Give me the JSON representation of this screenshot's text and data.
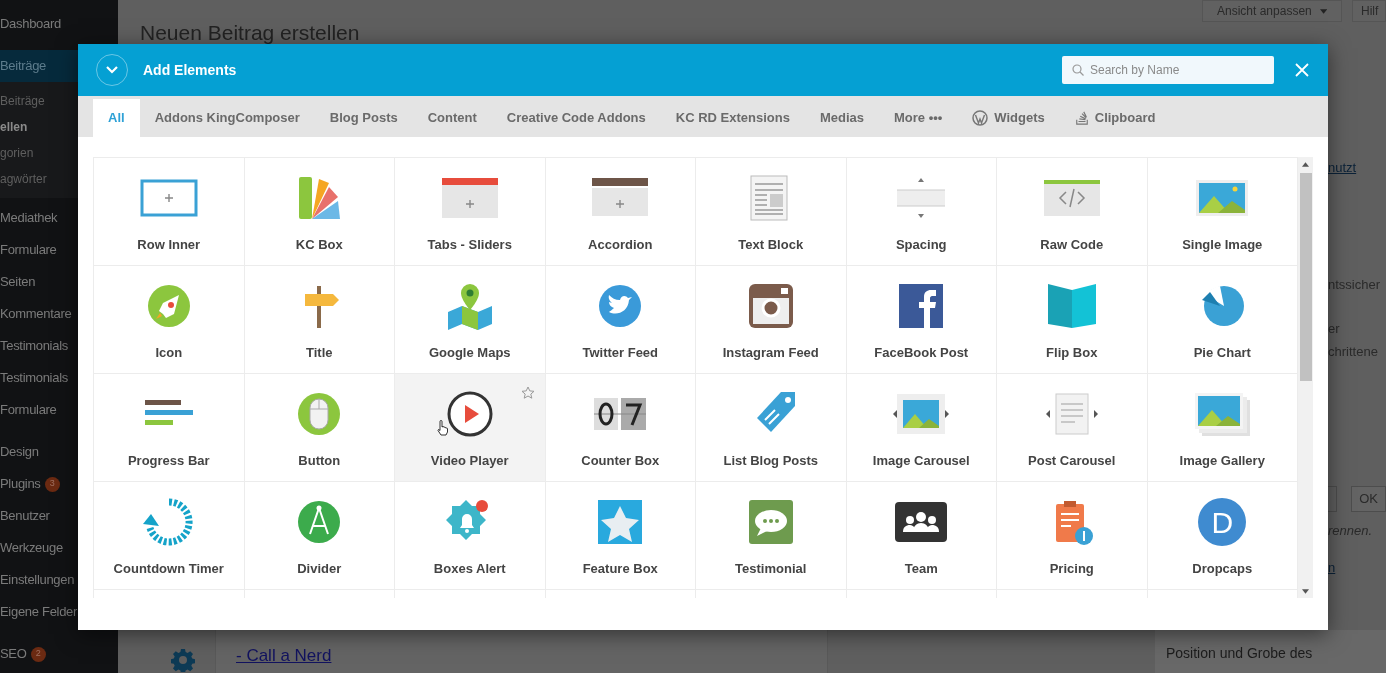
{
  "sidebar": {
    "groups": [
      [
        {
          "label": "Dashboard",
          "selected": false
        }
      ],
      [
        {
          "label": "Beiträge",
          "selected": true,
          "children": [
            {
              "label": "Beiträge",
              "current": false
            },
            {
              "label": "ellen",
              "current": true
            },
            {
              "label": "gorien",
              "current": false
            },
            {
              "label": "agwörter",
              "current": false
            }
          ]
        },
        {
          "label": "Mediathek",
          "selected": false
        },
        {
          "label": "Formulare",
          "selected": false
        },
        {
          "label": "Seiten",
          "selected": false
        },
        {
          "label": "Kommentare",
          "selected": false
        },
        {
          "label": "Testimonials",
          "selected": false
        },
        {
          "label": "Testimonials",
          "selected": false
        },
        {
          "label": "Formulare",
          "selected": false
        }
      ],
      [
        {
          "label": "Design",
          "selected": false
        },
        {
          "label": "Plugins",
          "selected": false,
          "badge": "3"
        },
        {
          "label": "Benutzer",
          "selected": false
        },
        {
          "label": "Werkzeuge",
          "selected": false
        },
        {
          "label": "Einstellungen",
          "selected": false
        },
        {
          "label": "Eigene Felder",
          "selected": false
        }
      ],
      [
        {
          "label": "SEO",
          "selected": false,
          "badge": "2"
        }
      ]
    ]
  },
  "page": {
    "title": "Neuen Beitrag erstellen",
    "header_buttons": [
      {
        "label": "Ansicht anpassen",
        "menu": true
      },
      {
        "label": "Hilf",
        "menu": false
      }
    ],
    "side_fragments": [
      {
        "text": "nutzt",
        "kind": "link"
      },
      {
        "text": "ntssicher",
        "kind": "text"
      },
      {
        "text": "er",
        "kind": "text"
      },
      {
        "text": "chrittene",
        "kind": "text"
      },
      {
        "text": "OK",
        "kind": "button"
      },
      {
        "text": "rennen.",
        "kind": "italic"
      },
      {
        "text": "n",
        "kind": "link"
      }
    ],
    "bottom_link": "- Call a Nerd",
    "bottom_panel_title": "Position und Grobe des"
  },
  "modal": {
    "title": "Add Elements",
    "search": {
      "placeholder": "Search by Name"
    },
    "tabs": [
      {
        "label": "All",
        "selected": true
      },
      {
        "label": "Addons KingComposer",
        "selected": false
      },
      {
        "label": "Blog Posts",
        "selected": false
      },
      {
        "label": "Content",
        "selected": false
      },
      {
        "label": "Creative Code Addons",
        "selected": false
      },
      {
        "label": "KC RD Extensions",
        "selected": false
      },
      {
        "label": "Medias",
        "selected": false
      },
      {
        "label": "More •••",
        "selected": false
      },
      {
        "label": "Widgets",
        "selected": false
      },
      {
        "label": "Clipboard",
        "selected": false
      }
    ],
    "elements": [
      {
        "label": "Row Inner",
        "hovered": false
      },
      {
        "label": "KC Box",
        "hovered": false
      },
      {
        "label": "Tabs - Sliders",
        "hovered": false
      },
      {
        "label": "Accordion",
        "hovered": false
      },
      {
        "label": "Text Block",
        "hovered": false
      },
      {
        "label": "Spacing",
        "hovered": false
      },
      {
        "label": "Raw Code",
        "hovered": false
      },
      {
        "label": "Single Image",
        "hovered": false
      },
      {
        "label": "Icon",
        "hovered": false
      },
      {
        "label": "Title",
        "hovered": false
      },
      {
        "label": "Google Maps",
        "hovered": false
      },
      {
        "label": "Twitter Feed",
        "hovered": false
      },
      {
        "label": "Instagram Feed",
        "hovered": false
      },
      {
        "label": "FaceBook Post",
        "hovered": false
      },
      {
        "label": "Flip Box",
        "hovered": false
      },
      {
        "label": "Pie Chart",
        "hovered": false
      },
      {
        "label": "Progress Bar",
        "hovered": false
      },
      {
        "label": "Button",
        "hovered": false
      },
      {
        "label": "Video Player",
        "hovered": true
      },
      {
        "label": "Counter Box",
        "hovered": false
      },
      {
        "label": "List Blog Posts",
        "hovered": false
      },
      {
        "label": "Image Carousel",
        "hovered": false
      },
      {
        "label": "Post Carousel",
        "hovered": false
      },
      {
        "label": "Image Gallery",
        "hovered": false
      },
      {
        "label": "Countdown Timer",
        "hovered": false
      },
      {
        "label": "Divider",
        "hovered": false
      },
      {
        "label": "Boxes Alert",
        "hovered": false
      },
      {
        "label": "Feature Box",
        "hovered": false
      },
      {
        "label": "Testimonial",
        "hovered": false
      },
      {
        "label": "Team",
        "hovered": false
      },
      {
        "label": "Pricing",
        "hovered": false
      },
      {
        "label": "Dropcaps",
        "hovered": false,
        "icon_text": "D"
      }
    ]
  }
}
